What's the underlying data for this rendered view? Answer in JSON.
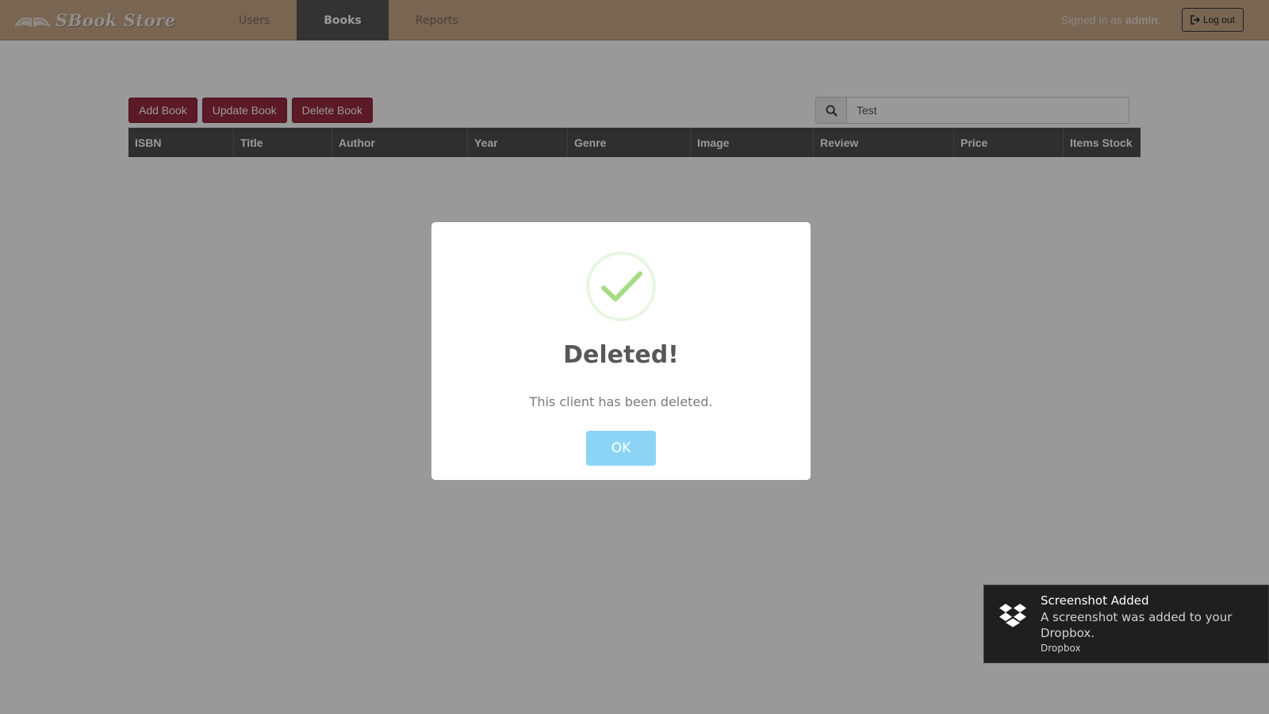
{
  "navbar": {
    "brand_text": "SBook Store",
    "brand_icon": "open-book-icon",
    "tabs": [
      {
        "label": "Users",
        "active": false
      },
      {
        "label": "Books",
        "active": true
      },
      {
        "label": "Reports",
        "active": false
      }
    ],
    "signed_in_prefix": "Signed in as",
    "signed_in_user": "admin",
    "signed_in_suffix": ".",
    "logout_label": "Log out"
  },
  "toolbar": {
    "add_label": "Add Book",
    "update_label": "Update Book",
    "delete_label": "Delete Book"
  },
  "search": {
    "value": "Test",
    "icon": "search-icon"
  },
  "table": {
    "columns": [
      "ISBN",
      "Title",
      "Author",
      "Year",
      "Genre",
      "Image",
      "Review",
      "Price",
      "Items Stock"
    ]
  },
  "modal": {
    "icon": "success-check-icon",
    "title": "Deleted!",
    "text": "This client has been deleted.",
    "ok_label": "OK"
  },
  "toast": {
    "icon": "dropbox-icon",
    "title": "Screenshot Added",
    "body": "A screenshot was added to your Dropbox.",
    "source": "Dropbox"
  },
  "colors": {
    "navbar": "#c9a889",
    "active_tab": "#555555",
    "action_button": "#9a2a44",
    "table_header": "#4f4f4f",
    "ok_button": "#8cd4f5",
    "success_check": "#a5dc86",
    "toast_bg": "#1f1f1f"
  }
}
